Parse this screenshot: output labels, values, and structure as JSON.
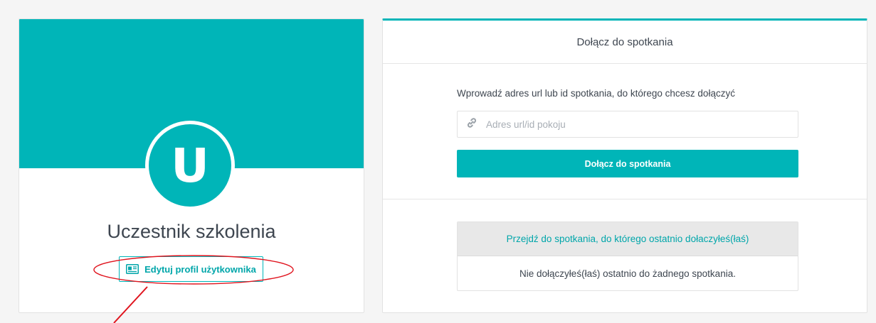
{
  "profile": {
    "avatar_letter": "U",
    "name": "Uczestnik szkolenia",
    "edit_button_label": "Edytuj profil użytkownika",
    "edit_button_icon": "id-card-icon"
  },
  "join": {
    "header_title": "Dołącz do spotkania",
    "prompt": "Wprowadź adres url lub id spotkania, do którego chcesz dołączyć",
    "input": {
      "value": "",
      "placeholder": "Adres url/id pokoju",
      "icon": "link-icon"
    },
    "join_button_label": "Dołącz do spotkania",
    "recent": {
      "link_label": "Przejdź do spotkania, do którego ostatnio dołaczyłeś(łaś)",
      "empty_message": "Nie dołączyłeś(łaś) ostatnio do żadnego spotkania."
    }
  },
  "colors": {
    "accent": "#00b5b8",
    "annotation": "#e0141e",
    "text": "#3e4650"
  }
}
